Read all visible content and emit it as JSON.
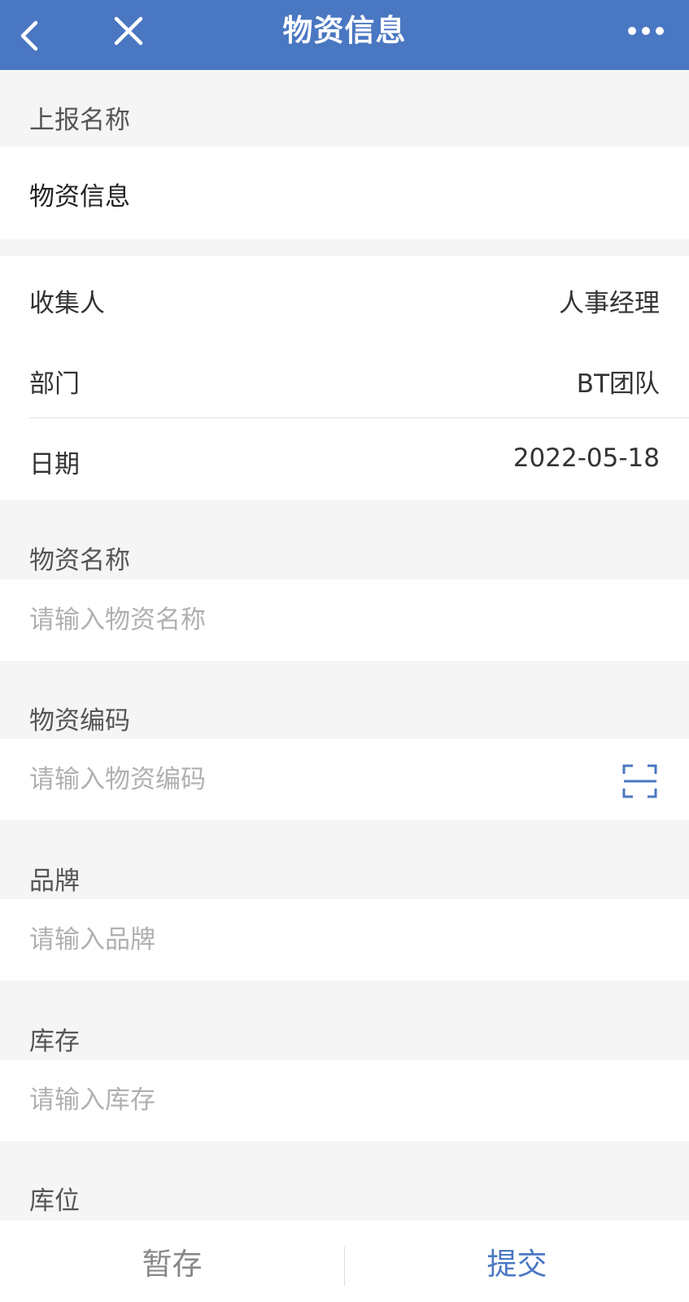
{
  "nav": {
    "title": "物资信息",
    "back_icon": "chevron-left-icon",
    "close_icon": "close-icon",
    "more_icon": "more-horizontal-icon"
  },
  "report": {
    "label": "上报名称",
    "value": "物资信息"
  },
  "info_rows": [
    {
      "label": "收集人",
      "value": "人事经理"
    },
    {
      "label": "部门",
      "value": "BT团队"
    },
    {
      "label": "日期",
      "value": "2022-05-18"
    }
  ],
  "fields": {
    "material_name": {
      "label": "物资名称",
      "placeholder": "请输入物资名称",
      "value": ""
    },
    "material_code": {
      "label": "物资编码",
      "placeholder": "请输入物资编码",
      "value": "",
      "scan_icon": "scan-icon"
    },
    "brand": {
      "label": "品牌",
      "placeholder": "请输入品牌",
      "value": ""
    },
    "stock": {
      "label": "库存",
      "placeholder": "请输入库存",
      "value": ""
    },
    "location": {
      "label": "库位"
    }
  },
  "actions": {
    "save_label": "暂存",
    "submit_label": "提交"
  },
  "colors": {
    "accent": "#4a77c2",
    "background": "#f5f5f5",
    "placeholder": "#b0b0b0"
  }
}
